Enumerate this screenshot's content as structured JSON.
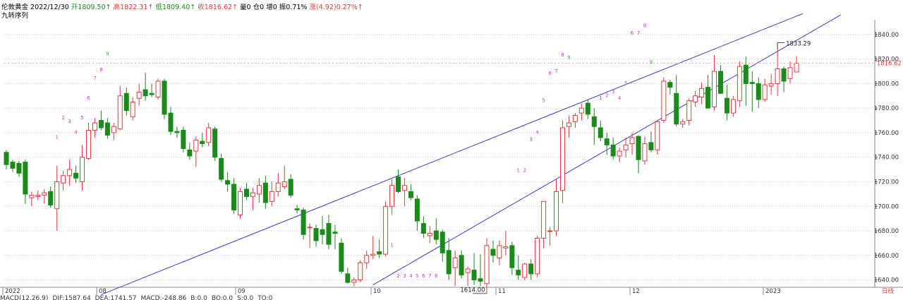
{
  "header": {
    "instrument": "伦敦黄金",
    "date": "2022/12/30",
    "open_label": "开",
    "open": "1809.50↑",
    "high_label": "高",
    "high": "1822.31↑",
    "low_label": "低",
    "low": "1809.40↑",
    "close_label": "收",
    "close": "1816.62↑",
    "volume": "量0",
    "position": "仓0",
    "increase": "增0",
    "amplitude": "振0.71%",
    "change_label": "涨",
    "change": "(4.92)0.27%↑",
    "indicator": "九转序列"
  },
  "colors": {
    "up": "#e83a3a",
    "down": "#1a8a1a",
    "channel": "#3a3ad8",
    "seq_magenta": "#cc33cc",
    "seq_green": "#33aa33",
    "grid": "#c8c8c8"
  },
  "axis": {
    "y_ticks": [
      "1640.00",
      "1660.00",
      "1680.00",
      "1700.00",
      "1720.00",
      "1740.00",
      "1760.00",
      "1780.00",
      "1800.00",
      "1820.00",
      "1840.00"
    ],
    "last_price": "1816.62",
    "x_labels": [
      "2022",
      "08",
      "09",
      "10",
      "11",
      "12",
      "2023"
    ],
    "period_label": "日线"
  },
  "annotations": {
    "high_mark": "1833.29",
    "low_mark": "1614.00"
  },
  "bottom_strip": {
    "items": [
      "MACD(12,26,9)",
      "DIF:1587.64",
      "DEA:1741.57",
      "MACD:-248.86",
      "B:0.0",
      "BO:0.0",
      "S:0.0",
      "TO:0"
    ]
  },
  "chart_data": {
    "type": "candlestick",
    "title": "伦敦黄金",
    "ylim": [
      1634,
      1852
    ],
    "y_ticks": [
      1640,
      1660,
      1680,
      1700,
      1720,
      1740,
      1760,
      1780,
      1800,
      1820,
      1840
    ],
    "x_labels": [
      "2022",
      "08",
      "09",
      "10",
      "11",
      "12",
      "2023"
    ],
    "last_price": 1816.62,
    "candles": [
      {
        "o": 1744,
        "h": 1746,
        "l": 1730,
        "c": 1734
      },
      {
        "o": 1736,
        "h": 1738,
        "l": 1728,
        "c": 1731
      },
      {
        "o": 1735,
        "h": 1737,
        "l": 1724,
        "c": 1727
      },
      {
        "o": 1736,
        "h": 1738,
        "l": 1702,
        "c": 1710
      },
      {
        "o": 1707,
        "h": 1712,
        "l": 1700,
        "c": 1709
      },
      {
        "o": 1708,
        "h": 1713,
        "l": 1705,
        "c": 1709
      },
      {
        "o": 1709,
        "h": 1714,
        "l": 1702,
        "c": 1711
      },
      {
        "o": 1712,
        "h": 1716,
        "l": 1699,
        "c": 1701
      },
      {
        "o": 1698,
        "h": 1733,
        "l": 1680,
        "c": 1720
      },
      {
        "o": 1719,
        "h": 1729,
        "l": 1713,
        "c": 1725
      },
      {
        "o": 1725,
        "h": 1738,
        "l": 1717,
        "c": 1730
      },
      {
        "o": 1727,
        "h": 1733,
        "l": 1719,
        "c": 1723
      },
      {
        "o": 1720,
        "h": 1750,
        "l": 1713,
        "c": 1740
      },
      {
        "o": 1739,
        "h": 1768,
        "l": 1738,
        "c": 1762
      },
      {
        "o": 1762,
        "h": 1772,
        "l": 1756,
        "c": 1768
      },
      {
        "o": 1770,
        "h": 1778,
        "l": 1762,
        "c": 1764
      },
      {
        "o": 1768,
        "h": 1772,
        "l": 1755,
        "c": 1758
      },
      {
        "o": 1760,
        "h": 1768,
        "l": 1754,
        "c": 1765
      },
      {
        "o": 1763,
        "h": 1798,
        "l": 1762,
        "c": 1790
      },
      {
        "o": 1792,
        "h": 1797,
        "l": 1774,
        "c": 1778
      },
      {
        "o": 1773,
        "h": 1789,
        "l": 1770,
        "c": 1785
      },
      {
        "o": 1788,
        "h": 1800,
        "l": 1782,
        "c": 1793
      },
      {
        "o": 1795,
        "h": 1809,
        "l": 1786,
        "c": 1790
      },
      {
        "o": 1792,
        "h": 1800,
        "l": 1789,
        "c": 1791
      },
      {
        "o": 1789,
        "h": 1804,
        "l": 1787,
        "c": 1802
      },
      {
        "o": 1802,
        "h": 1804,
        "l": 1771,
        "c": 1775
      },
      {
        "o": 1776,
        "h": 1781,
        "l": 1758,
        "c": 1761
      },
      {
        "o": 1761,
        "h": 1765,
        "l": 1756,
        "c": 1760
      },
      {
        "o": 1762,
        "h": 1765,
        "l": 1744,
        "c": 1747
      },
      {
        "o": 1746,
        "h": 1752,
        "l": 1738,
        "c": 1741
      },
      {
        "o": 1745,
        "h": 1757,
        "l": 1732,
        "c": 1754
      },
      {
        "o": 1753,
        "h": 1760,
        "l": 1748,
        "c": 1751
      },
      {
        "o": 1752,
        "h": 1768,
        "l": 1749,
        "c": 1764
      },
      {
        "o": 1763,
        "h": 1765,
        "l": 1737,
        "c": 1740
      },
      {
        "o": 1739,
        "h": 1743,
        "l": 1720,
        "c": 1722
      },
      {
        "o": 1721,
        "h": 1728,
        "l": 1712,
        "c": 1718
      },
      {
        "o": 1718,
        "h": 1723,
        "l": 1694,
        "c": 1697
      },
      {
        "o": 1693,
        "h": 1715,
        "l": 1690,
        "c": 1712
      },
      {
        "o": 1714,
        "h": 1719,
        "l": 1705,
        "c": 1708
      },
      {
        "o": 1708,
        "h": 1715,
        "l": 1697,
        "c": 1711
      },
      {
        "o": 1710,
        "h": 1723,
        "l": 1703,
        "c": 1717
      },
      {
        "o": 1719,
        "h": 1725,
        "l": 1698,
        "c": 1703
      },
      {
        "o": 1704,
        "h": 1720,
        "l": 1700,
        "c": 1712
      },
      {
        "o": 1712,
        "h": 1727,
        "l": 1708,
        "c": 1719
      },
      {
        "o": 1716,
        "h": 1733,
        "l": 1714,
        "c": 1720
      },
      {
        "o": 1722,
        "h": 1726,
        "l": 1707,
        "c": 1709
      },
      {
        "o": 1698,
        "h": 1701,
        "l": 1694,
        "c": 1697
      },
      {
        "o": 1697,
        "h": 1699,
        "l": 1673,
        "c": 1677
      },
      {
        "o": 1683,
        "h": 1686,
        "l": 1666,
        "c": 1683
      },
      {
        "o": 1682,
        "h": 1685,
        "l": 1667,
        "c": 1672
      },
      {
        "o": 1681,
        "h": 1692,
        "l": 1669,
        "c": 1677
      },
      {
        "o": 1686,
        "h": 1693,
        "l": 1665,
        "c": 1669
      },
      {
        "o": 1679,
        "h": 1685,
        "l": 1665,
        "c": 1678
      },
      {
        "o": 1670,
        "h": 1674,
        "l": 1645,
        "c": 1647
      },
      {
        "o": 1645,
        "h": 1650,
        "l": 1637,
        "c": 1638
      },
      {
        "o": 1638,
        "h": 1642,
        "l": 1635,
        "c": 1640
      },
      {
        "o": 1640,
        "h": 1656,
        "l": 1638,
        "c": 1654
      },
      {
        "o": 1654,
        "h": 1664,
        "l": 1649,
        "c": 1660
      },
      {
        "o": 1660,
        "h": 1676,
        "l": 1657,
        "c": 1661
      },
      {
        "o": 1663,
        "h": 1673,
        "l": 1658,
        "c": 1661
      },
      {
        "o": 1661,
        "h": 1704,
        "l": 1659,
        "c": 1700
      },
      {
        "o": 1700,
        "h": 1722,
        "l": 1693,
        "c": 1717
      },
      {
        "o": 1724,
        "h": 1730,
        "l": 1711,
        "c": 1712
      },
      {
        "o": 1713,
        "h": 1723,
        "l": 1700,
        "c": 1717
      },
      {
        "o": 1712,
        "h": 1718,
        "l": 1705,
        "c": 1707
      },
      {
        "o": 1706,
        "h": 1709,
        "l": 1680,
        "c": 1688
      },
      {
        "o": 1686,
        "h": 1692,
        "l": 1674,
        "c": 1678
      },
      {
        "o": 1676,
        "h": 1684,
        "l": 1670,
        "c": 1678
      },
      {
        "o": 1680,
        "h": 1690,
        "l": 1669,
        "c": 1673
      },
      {
        "o": 1679,
        "h": 1681,
        "l": 1655,
        "c": 1662
      },
      {
        "o": 1664,
        "h": 1674,
        "l": 1640,
        "c": 1645
      },
      {
        "o": 1650,
        "h": 1664,
        "l": 1635,
        "c": 1658
      },
      {
        "o": 1660,
        "h": 1664,
        "l": 1641,
        "c": 1644
      },
      {
        "o": 1646,
        "h": 1651,
        "l": 1635,
        "c": 1649
      },
      {
        "o": 1648,
        "h": 1662,
        "l": 1636,
        "c": 1640
      },
      {
        "o": 1641,
        "h": 1661,
        "l": 1635,
        "c": 1639
      },
      {
        "o": 1637,
        "h": 1674,
        "l": 1629,
        "c": 1668
      },
      {
        "o": 1665,
        "h": 1672,
        "l": 1654,
        "c": 1660
      },
      {
        "o": 1658,
        "h": 1672,
        "l": 1652,
        "c": 1668
      },
      {
        "o": 1666,
        "h": 1680,
        "l": 1660,
        "c": 1667
      },
      {
        "o": 1668,
        "h": 1671,
        "l": 1644,
        "c": 1650
      },
      {
        "o": 1648,
        "h": 1660,
        "l": 1640,
        "c": 1644
      },
      {
        "o": 1642,
        "h": 1654,
        "l": 1640,
        "c": 1653
      },
      {
        "o": 1653,
        "h": 1657,
        "l": 1640,
        "c": 1645
      },
      {
        "o": 1645,
        "h": 1676,
        "l": 1642,
        "c": 1674
      },
      {
        "o": 1674,
        "h": 1704,
        "l": 1666,
        "c": 1704
      },
      {
        "o": 1680,
        "h": 1683,
        "l": 1668,
        "c": 1680
      },
      {
        "o": 1680,
        "h": 1722,
        "l": 1676,
        "c": 1712
      },
      {
        "o": 1713,
        "h": 1770,
        "l": 1703,
        "c": 1764
      },
      {
        "o": 1765,
        "h": 1774,
        "l": 1756,
        "c": 1768
      },
      {
        "o": 1769,
        "h": 1776,
        "l": 1764,
        "c": 1774
      },
      {
        "o": 1776,
        "h": 1784,
        "l": 1770,
        "c": 1780
      },
      {
        "o": 1784,
        "h": 1787,
        "l": 1771,
        "c": 1775
      },
      {
        "o": 1773,
        "h": 1780,
        "l": 1750,
        "c": 1765
      },
      {
        "o": 1764,
        "h": 1770,
        "l": 1753,
        "c": 1756
      },
      {
        "o": 1755,
        "h": 1760,
        "l": 1742,
        "c": 1750
      },
      {
        "o": 1750,
        "h": 1756,
        "l": 1738,
        "c": 1741
      },
      {
        "o": 1741,
        "h": 1748,
        "l": 1736,
        "c": 1745
      },
      {
        "o": 1746,
        "h": 1756,
        "l": 1740,
        "c": 1750
      },
      {
        "o": 1751,
        "h": 1760,
        "l": 1742,
        "c": 1756
      },
      {
        "o": 1757,
        "h": 1758,
        "l": 1727,
        "c": 1738
      },
      {
        "o": 1737,
        "h": 1757,
        "l": 1734,
        "c": 1751
      },
      {
        "o": 1752,
        "h": 1761,
        "l": 1744,
        "c": 1746
      },
      {
        "o": 1746,
        "h": 1770,
        "l": 1742,
        "c": 1769
      },
      {
        "o": 1770,
        "h": 1805,
        "l": 1768,
        "c": 1802
      },
      {
        "o": 1801,
        "h": 1803,
        "l": 1791,
        "c": 1797
      },
      {
        "o": 1792,
        "h": 1807,
        "l": 1765,
        "c": 1767
      },
      {
        "o": 1767,
        "h": 1771,
        "l": 1764,
        "c": 1769
      },
      {
        "o": 1770,
        "h": 1788,
        "l": 1766,
        "c": 1786
      },
      {
        "o": 1785,
        "h": 1794,
        "l": 1781,
        "c": 1790
      },
      {
        "o": 1789,
        "h": 1801,
        "l": 1783,
        "c": 1796
      },
      {
        "o": 1797,
        "h": 1807,
        "l": 1782,
        "c": 1780
      },
      {
        "o": 1781,
        "h": 1823,
        "l": 1778,
        "c": 1810
      },
      {
        "o": 1810,
        "h": 1815,
        "l": 1795,
        "c": 1792
      },
      {
        "o": 1788,
        "h": 1799,
        "l": 1770,
        "c": 1776
      },
      {
        "o": 1776,
        "h": 1790,
        "l": 1773,
        "c": 1787
      },
      {
        "o": 1786,
        "h": 1818,
        "l": 1781,
        "c": 1814
      },
      {
        "o": 1815,
        "h": 1822,
        "l": 1782,
        "c": 1800
      },
      {
        "o": 1801,
        "h": 1810,
        "l": 1777,
        "c": 1800
      },
      {
        "o": 1800,
        "h": 1805,
        "l": 1780,
        "c": 1787
      },
      {
        "o": 1787,
        "h": 1804,
        "l": 1785,
        "c": 1799
      },
      {
        "o": 1798,
        "h": 1808,
        "l": 1791,
        "c": 1800
      },
      {
        "o": 1800,
        "h": 1833.29,
        "l": 1790,
        "c": 1812
      },
      {
        "o": 1812,
        "h": 1814,
        "l": 1793,
        "c": 1802
      },
      {
        "o": 1804,
        "h": 1818,
        "l": 1800,
        "c": 1813
      },
      {
        "o": 1809.5,
        "h": 1822.31,
        "l": 1809.4,
        "c": 1816.62
      }
    ],
    "channel_upper": [
      {
        "i": 15,
        "p": 1628
      },
      {
        "i": 126,
        "p": 1857
      }
    ],
    "channel_lower": [
      {
        "i": 58,
        "p": 1636
      },
      {
        "i": 132,
        "p": 1856
      }
    ],
    "td_sequences": [
      {
        "i": 8,
        "n": "1",
        "p": 1755,
        "color": "magenta"
      },
      {
        "i": 9,
        "n": "2",
        "p": 1771,
        "color": "magenta"
      },
      {
        "i": 10,
        "n": "3",
        "p": 1768,
        "color": "magenta"
      },
      {
        "i": 11,
        "n": "4",
        "p": 1759,
        "color": "magenta"
      },
      {
        "i": 12,
        "n": "5",
        "p": 1771,
        "color": "magenta"
      },
      {
        "i": 13,
        "n": "6",
        "p": 1787,
        "color": "magenta"
      },
      {
        "i": 14,
        "n": "7",
        "p": 1803,
        "color": "magenta"
      },
      {
        "i": 15,
        "n": "8",
        "p": 1810,
        "color": "magenta"
      },
      {
        "i": 16,
        "n": "9",
        "p": 1823,
        "color": "green"
      },
      {
        "i": 61,
        "n": "1",
        "p": 1667,
        "color": "magenta"
      },
      {
        "i": 62,
        "n": "2",
        "p": 1642,
        "color": "magenta"
      },
      {
        "i": 63,
        "n": "3",
        "p": 1642,
        "color": "magenta"
      },
      {
        "i": 64,
        "n": "4",
        "p": 1642,
        "color": "magenta"
      },
      {
        "i": 65,
        "n": "5",
        "p": 1642,
        "color": "magenta"
      },
      {
        "i": 66,
        "n": "6",
        "p": 1642,
        "color": "magenta"
      },
      {
        "i": 67,
        "n": "7",
        "p": 1642,
        "color": "magenta"
      },
      {
        "i": 68,
        "n": "8",
        "p": 1642,
        "color": "magenta"
      },
      {
        "i": 81,
        "n": "1",
        "p": 1728,
        "color": "magenta"
      },
      {
        "i": 82,
        "n": "2",
        "p": 1728,
        "color": "magenta"
      },
      {
        "i": 83,
        "n": "3",
        "p": 1753,
        "color": "magenta"
      },
      {
        "i": 84,
        "n": "4",
        "p": 1759,
        "color": "magenta"
      },
      {
        "i": 85,
        "n": "5",
        "p": 1785,
        "color": "magenta"
      },
      {
        "i": 86,
        "n": "6",
        "p": 1807,
        "color": "magenta"
      },
      {
        "i": 87,
        "n": "7",
        "p": 1809,
        "color": "magenta"
      },
      {
        "i": 88,
        "n": "8",
        "p": 1822,
        "color": "magenta"
      },
      {
        "i": 89,
        "n": "9",
        "p": 1820,
        "color": "green"
      },
      {
        "i": 94,
        "n": "1",
        "p": 1787,
        "color": "magenta"
      },
      {
        "i": 95,
        "n": "2",
        "p": 1789,
        "color": "magenta"
      },
      {
        "i": 96,
        "n": "3",
        "p": 1792,
        "color": "magenta"
      },
      {
        "i": 97,
        "n": "4",
        "p": 1787,
        "color": "magenta"
      },
      {
        "i": 98,
        "n": "5",
        "p": 1799,
        "color": "magenta"
      },
      {
        "i": 99,
        "n": "6",
        "p": 1840,
        "color": "magenta"
      },
      {
        "i": 100,
        "n": "7",
        "p": 1840,
        "color": "magenta"
      },
      {
        "i": 101,
        "n": "8",
        "p": 1846,
        "color": "magenta"
      },
      {
        "i": 102,
        "n": "9",
        "p": 1816,
        "color": "green"
      }
    ]
  }
}
